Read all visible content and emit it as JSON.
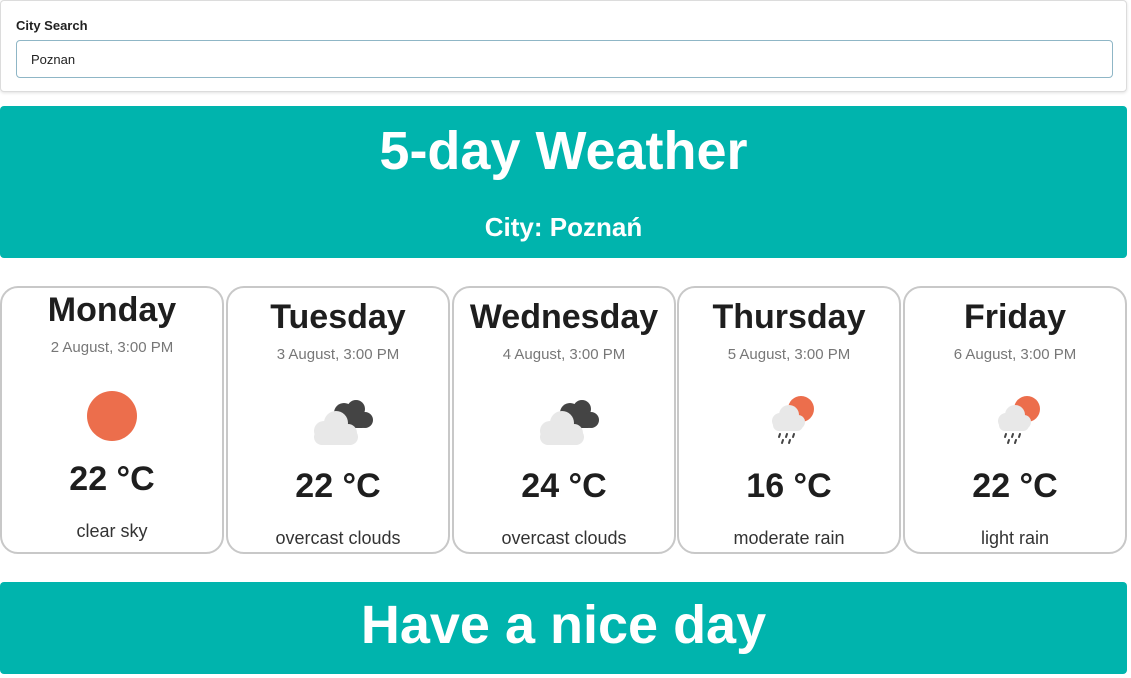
{
  "search": {
    "label": "City Search",
    "value": "Poznan"
  },
  "header": {
    "title": "5-day Weather",
    "city": "City: Poznań"
  },
  "forecast": [
    {
      "day": "Monday",
      "date": "2 August, 3:00 PM",
      "icon": "clear-sky-icon",
      "temp": "22 °C",
      "desc": "clear sky"
    },
    {
      "day": "Tuesday",
      "date": "3 August, 3:00 PM",
      "icon": "overcast-clouds-icon",
      "temp": "22 °C",
      "desc": "overcast clouds"
    },
    {
      "day": "Wednesday",
      "date": "4 August, 3:00 PM",
      "icon": "overcast-clouds-icon",
      "temp": "24 °C",
      "desc": "overcast clouds"
    },
    {
      "day": "Thursday",
      "date": "5 August, 3:00 PM",
      "icon": "rain-icon",
      "temp": "16 °C",
      "desc": "moderate rain"
    },
    {
      "day": "Friday",
      "date": "6 August, 3:00 PM",
      "icon": "rain-icon",
      "temp": "22 °C",
      "desc": "light rain"
    }
  ],
  "footer": {
    "text": "Have a nice day"
  },
  "colors": {
    "accent": "#00b4ad",
    "sun": "#ec6e4c",
    "cloud_light": "#e8e8e8",
    "cloud_dark": "#444444"
  }
}
